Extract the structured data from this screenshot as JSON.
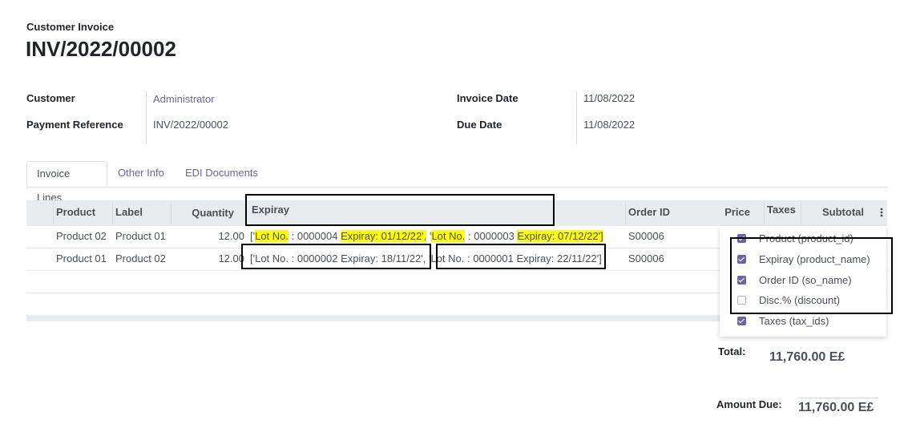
{
  "header": {
    "doc_type": "Customer Invoice",
    "invoice_number": "INV/2022/00002"
  },
  "fields": {
    "customer_label": "Customer",
    "customer_value": "Administrator",
    "payment_ref_label": "Payment Reference",
    "payment_ref_value": "INV/2022/00002",
    "invoice_date_label": "Invoice Date",
    "invoice_date_value": "11/08/2022",
    "due_date_label": "Due Date",
    "due_date_value": "11/08/2022"
  },
  "tabs": [
    {
      "label": "Invoice Lines",
      "active": true
    },
    {
      "label": "Other Info",
      "active": false
    },
    {
      "label": "EDI Documents",
      "active": false
    }
  ],
  "table": {
    "columns": [
      "Product",
      "Label",
      "Quantity",
      "Expiray",
      "Order ID",
      "Price",
      "Taxes",
      "Subtotal"
    ],
    "rows": [
      {
        "product": "Product 02",
        "label": "Product 01",
        "quantity": "12.00",
        "expiray": {
          "p1": "['",
          "p2": "Lot No.",
          "p3": " : 0000004 ",
          "p4": "Expiray: 01/12/22',",
          "p5": " '",
          "p6": "Lot No.",
          "p7": " : 0000003 ",
          "p8": "Expiray: 07/12/22']"
        },
        "order_id": "S00006"
      },
      {
        "product": "Product 01",
        "label": "Product 02",
        "quantity": "12.00",
        "expiray": {
          "a": "['",
          "b": "Lot No. : 0000002 Expiray: 18/11/22',",
          "c": " '",
          "d": "Lot No. : 0000001 Expiray: 22/11/22']"
        },
        "order_id": "S00006"
      }
    ]
  },
  "column_options": [
    {
      "label": "Product (product_id)",
      "checked": true
    },
    {
      "label": "Expiray (product_name)",
      "checked": true
    },
    {
      "label": "Order ID (so_name)",
      "checked": true
    },
    {
      "label": "Disc.% (discount)",
      "checked": false
    },
    {
      "label": "Taxes (tax_ids)",
      "checked": true
    }
  ],
  "totals": {
    "total_label": "Total:",
    "total_value": "11,760.00 E£",
    "amount_due_label": "Amount Due:",
    "amount_due_value": "11,760.00 E£"
  },
  "colors": {
    "accent": "#71639e",
    "highlight": "#ffff00",
    "annotation_box": "#000000"
  },
  "icons": {
    "optional_columns": "kebab-vertical-icon"
  }
}
